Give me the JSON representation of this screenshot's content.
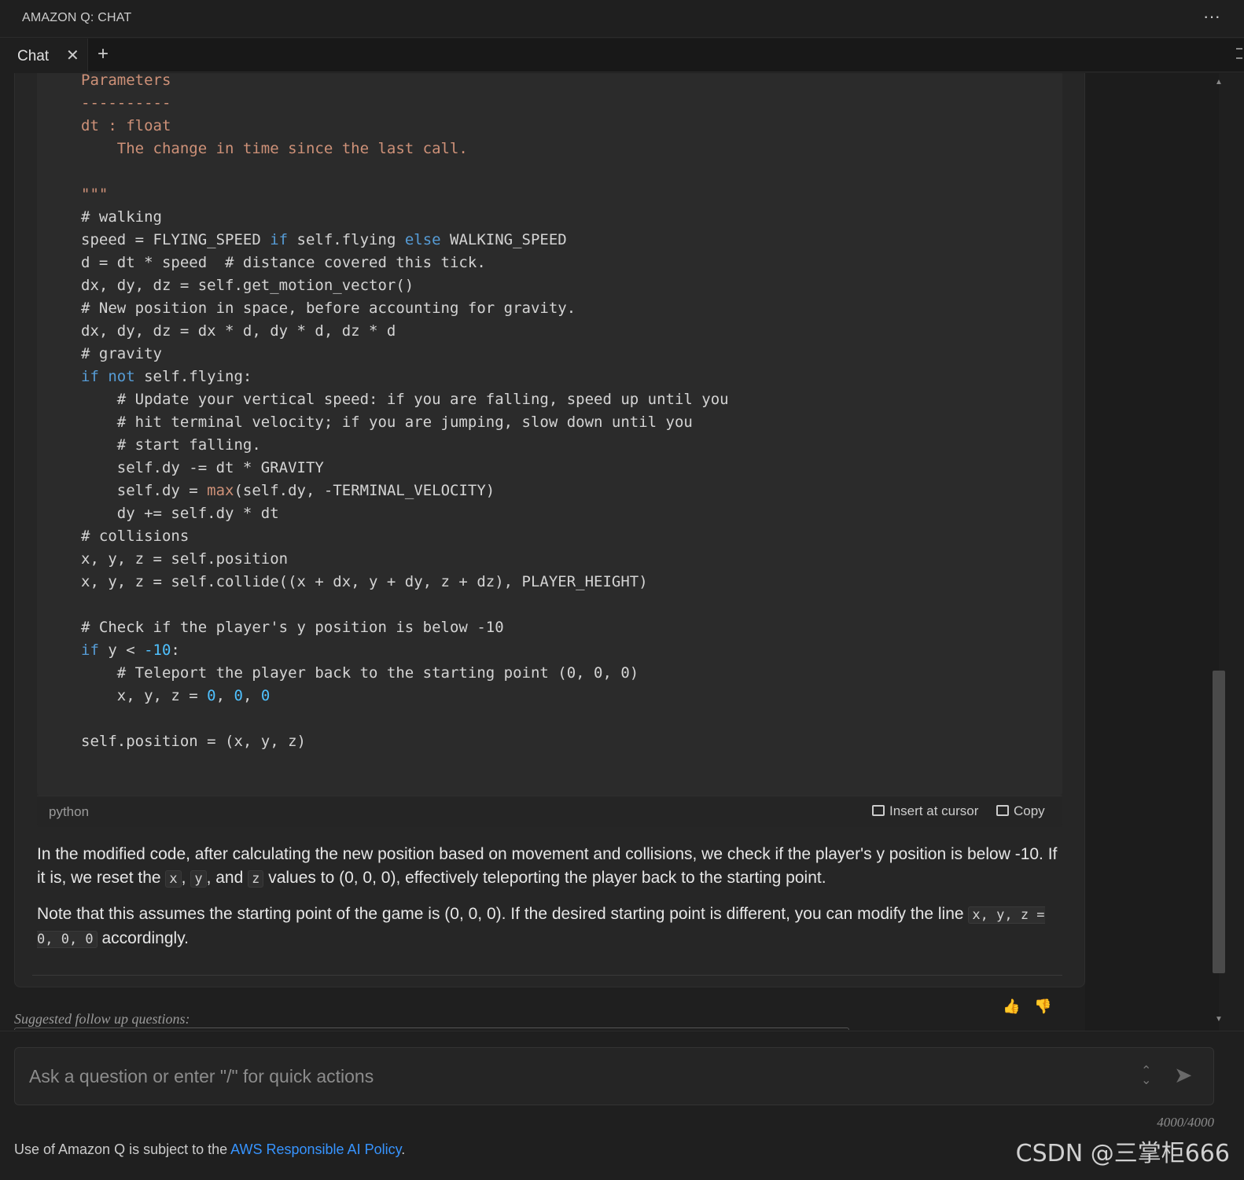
{
  "panel": {
    "title": "AMAZON Q: CHAT",
    "more_label": "···"
  },
  "tabs": [
    {
      "label": "Chat",
      "close": "✕"
    }
  ],
  "tab_add": "+",
  "code_block": {
    "language": "python",
    "insert_label": "Insert at cursor",
    "copy_label": "Copy"
  },
  "prose": {
    "p1_a": "In the modified code, after calculating the new position based on movement and collisions, we check if the player's y position is below -10. If it is, we reset the ",
    "p1_x": "x",
    "p1_sep1": ", ",
    "p1_y": "y",
    "p1_sep2": ", and ",
    "p1_z": "z",
    "p1_b": " values to (0, 0, 0), effectively teleporting the player back to the starting point.",
    "p2_a": "Note that this assumes the starting point of the game is (0, 0, 0). If the desired starting point is different, you can modify the line ",
    "p2_code": "x, y, z = 0, 0, 0",
    "p2_b": " accordingly."
  },
  "feedback": {
    "up": "👍",
    "down": "👎"
  },
  "followup": {
    "label": "Suggested follow up questions:"
  },
  "prompt": {
    "placeholder": "Ask a question or enter \"/\" for quick actions",
    "value": "",
    "char_count": "4000/4000"
  },
  "footer": {
    "text": "Use of Amazon Q is subject to the ",
    "link": "AWS Responsible AI Policy",
    "end": "."
  },
  "watermark": "CSDN @三掌柜666",
  "colors": {
    "keyword": "#569cd6",
    "string": "#ce9178",
    "number": "#4fc1ff",
    "link": "#3794ff"
  }
}
